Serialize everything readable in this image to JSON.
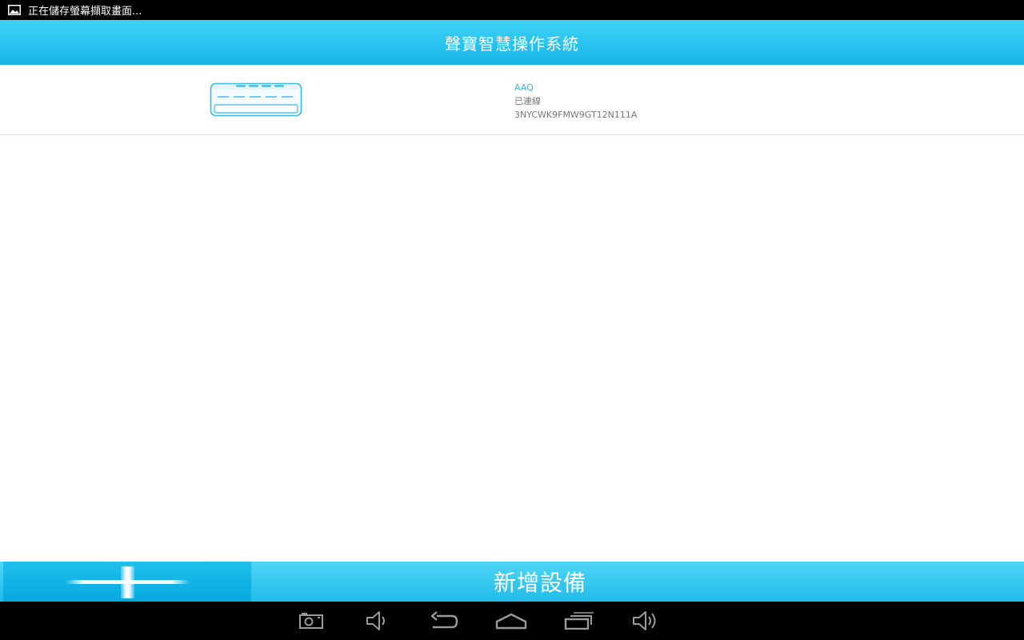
{
  "statusbar": {
    "notification_icon": "image-icon",
    "notification_text": "正在儲存螢幕擷取畫面..."
  },
  "header": {
    "title": "聲寶智慧操作系統"
  },
  "devices": [
    {
      "icon": "air-conditioner-icon",
      "name": "AAQ",
      "status": "已連線",
      "serial": "3NYCWK9FMW9GT12N111A"
    }
  ],
  "footer": {
    "add_icon": "plus-icon",
    "add_label": "新增設備"
  },
  "navbar": {
    "buttons": [
      "camera-icon",
      "volume-down-icon",
      "back-icon",
      "home-icon",
      "recent-apps-icon",
      "volume-up-icon"
    ]
  },
  "colors": {
    "accent": "#17b5e8",
    "device_name": "#2fb6e6",
    "status_text": "#777777"
  }
}
